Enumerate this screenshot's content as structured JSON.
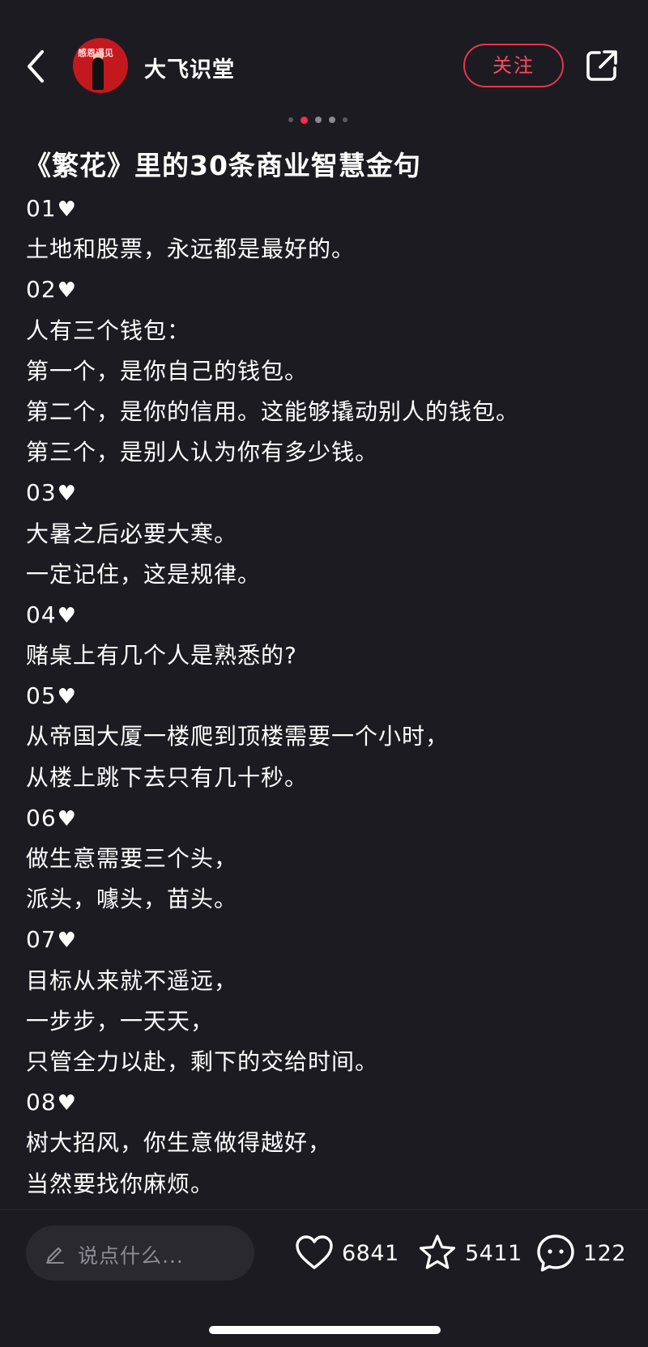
{
  "header": {
    "username": "大飞识堂",
    "avatar_text": "感恩遇见",
    "follow_label": "关注",
    "icons": {
      "back": "chevron-left-icon",
      "share": "share-external-icon"
    },
    "accent_color": "#ff2a44"
  },
  "pager": {
    "total_dots": 5,
    "active_index": 1
  },
  "post": {
    "title": "《繁花》里的30条商业智慧金句",
    "lines": [
      {
        "text": "01",
        "heart": "♥"
      },
      {
        "text": "土地和股票，永远都是最好的。"
      },
      {
        "text": "02",
        "heart": "♥"
      },
      {
        "text": "人有三个钱包："
      },
      {
        "text": "第一个，是你自己的钱包。"
      },
      {
        "text": "第二个，是你的信用。这能够撬动别人的钱包。"
      },
      {
        "text": "第三个，是别人认为你有多少钱。"
      },
      {
        "text": "03",
        "heart": "♥"
      },
      {
        "text": "大暑之后必要大寒。"
      },
      {
        "text": "一定记住，这是规律。"
      },
      {
        "text": "04",
        "heart": "♥"
      },
      {
        "text": "赌桌上有几个人是熟悉的?"
      },
      {
        "text": "05",
        "heart": "♥"
      },
      {
        "text": "从帝国大厦一楼爬到顶楼需要一个小时，"
      },
      {
        "text": "从楼上跳下去只有几十秒。"
      },
      {
        "text": "06",
        "heart": "♥"
      },
      {
        "text": "做生意需要三个头，"
      },
      {
        "text": "派头，噱头，苗头。"
      },
      {
        "text": "07",
        "heart": "♥"
      },
      {
        "text": "目标从来就不遥远，"
      },
      {
        "text": "一步步，一天天，"
      },
      {
        "text": "只管全力以赴，剩下的交给时间。"
      },
      {
        "text": "08",
        "heart": "♥"
      },
      {
        "text": "树大招风，你生意做得越好，"
      },
      {
        "text": "当然要找你麻烦。"
      }
    ]
  },
  "bottom_bar": {
    "comment_placeholder": "说点什么...",
    "likes": "6841",
    "stars": "5411",
    "comments": "122",
    "icons": {
      "pencil": "pencil-icon",
      "like": "heart-outline-icon",
      "star": "star-outline-icon",
      "comment": "chat-bubble-icon"
    }
  }
}
